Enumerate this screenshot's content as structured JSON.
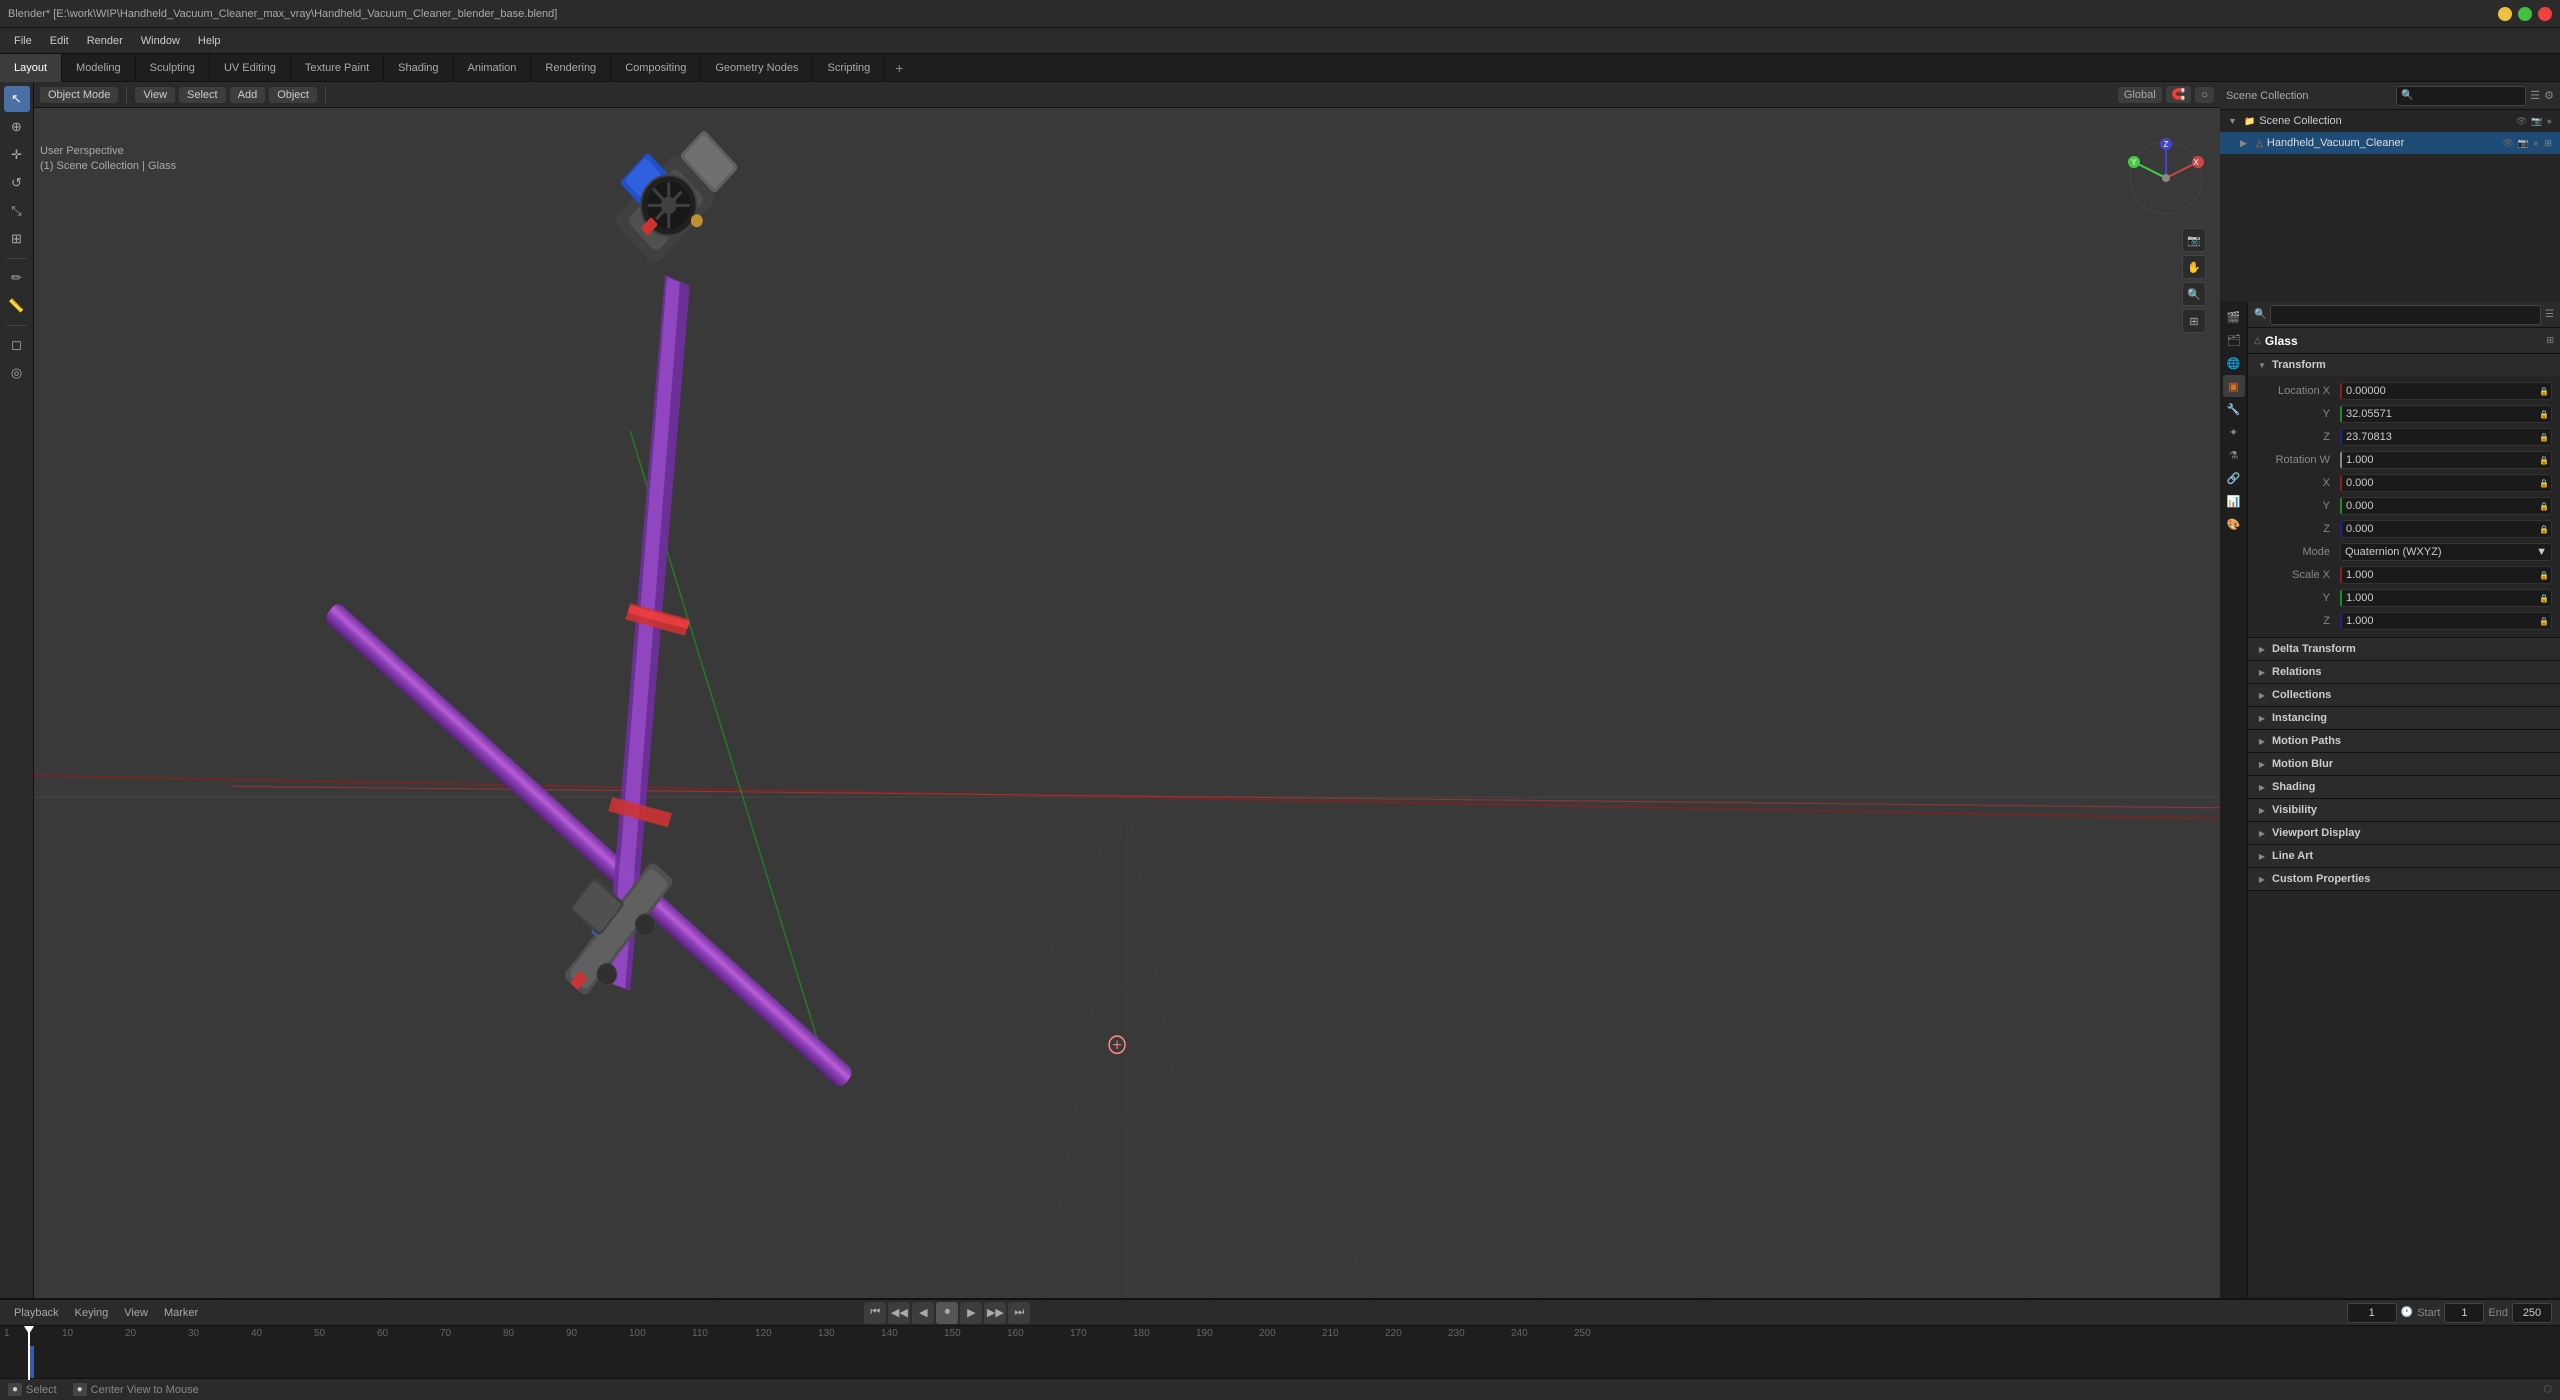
{
  "titlebar": {
    "title": "Blender* [E:\\work\\WIP\\Handheld_Vacuum_Cleaner_max_vray\\Handheld_Vacuum_Cleaner_blender_base.blend]"
  },
  "menus": {
    "items": [
      "File",
      "Edit",
      "Render",
      "Window",
      "Help"
    ]
  },
  "workspace_tabs": {
    "tabs": [
      "Layout",
      "Modeling",
      "Sculpting",
      "UV Editing",
      "Texture Paint",
      "Shading",
      "Animation",
      "Rendering",
      "Compositing",
      "Geometry Nodes",
      "Scripting"
    ],
    "active": "Layout",
    "plus": "+"
  },
  "viewport": {
    "mode": "Object Mode",
    "view_label": "View",
    "select_label": "Select",
    "add_label": "Add",
    "object_label": "Object",
    "transform_global": "Global",
    "overlay_info": {
      "line1": "User Perspective",
      "line2": "(1) Scene Collection | Glass"
    }
  },
  "left_toolbar": {
    "tools": [
      {
        "name": "select-tool",
        "icon": "↖",
        "active": true
      },
      {
        "name": "cursor-tool",
        "icon": "⊕",
        "active": false
      },
      {
        "name": "move-tool",
        "icon": "✛",
        "active": false
      },
      {
        "name": "rotate-tool",
        "icon": "↺",
        "active": false
      },
      {
        "name": "scale-tool",
        "icon": "⤡",
        "active": false
      },
      {
        "name": "transform-tool",
        "icon": "⊞",
        "active": false
      },
      {
        "name": "separator1",
        "separator": true
      },
      {
        "name": "annotate-tool",
        "icon": "✏",
        "active": false
      },
      {
        "name": "measure-tool",
        "icon": "📏",
        "active": false
      },
      {
        "name": "separator2",
        "separator": true
      },
      {
        "name": "object-tool",
        "icon": "◻",
        "active": false
      },
      {
        "name": "origin-tool",
        "icon": "◎",
        "active": false
      }
    ]
  },
  "outliner": {
    "title": "Scene Collection",
    "items": [
      {
        "name": "Scene Collection",
        "level": 0,
        "icon": "▼",
        "type": "collection"
      },
      {
        "name": "Handheld_Vacuum_Cleaner",
        "level": 1,
        "icon": "▶",
        "type": "object",
        "selected": true
      }
    ]
  },
  "properties": {
    "object_name": "Glass",
    "active_tab": "object",
    "tabs_icons": [
      "📷",
      "🔴",
      "🌐",
      "⬛",
      "👁",
      "✦",
      "🔗",
      "🧲",
      "🔧"
    ],
    "transform": {
      "title": "Transform",
      "location": {
        "label": "Location",
        "x": {
          "label": "X",
          "value": "0.00000"
        },
        "y": {
          "label": "Y",
          "value": "32.05571"
        },
        "z": {
          "label": "Z",
          "value": "23.70813"
        }
      },
      "rotation": {
        "label": "Rotation",
        "w": {
          "label": "W",
          "value": "1.000"
        },
        "x": {
          "label": "X",
          "value": "0.000"
        },
        "y": {
          "label": "Y",
          "value": "0.000"
        },
        "z": {
          "label": "Z",
          "value": "0.000"
        }
      },
      "mode": {
        "label": "Mode",
        "value": "Quaternion (WXYZ)"
      },
      "scale": {
        "label": "Scale",
        "x": {
          "label": "X",
          "value": "1.000"
        },
        "y": {
          "label": "Y",
          "value": "1.000"
        },
        "z": {
          "label": "Z",
          "value": "1.000"
        }
      }
    },
    "sections": [
      {
        "title": "Delta Transform",
        "collapsed": true
      },
      {
        "title": "Relations",
        "collapsed": true
      },
      {
        "title": "Collections",
        "collapsed": true
      },
      {
        "title": "Instancing",
        "collapsed": true
      },
      {
        "title": "Motion Paths",
        "collapsed": true
      },
      {
        "title": "Motion Blur",
        "collapsed": true
      },
      {
        "title": "Shading",
        "collapsed": true
      },
      {
        "title": "Visibility",
        "collapsed": true
      },
      {
        "title": "Viewport Display",
        "collapsed": true
      },
      {
        "title": "Line Art",
        "collapsed": true
      },
      {
        "title": "Custom Properties",
        "collapsed": true
      }
    ]
  },
  "timeline": {
    "menus": [
      "Playback",
      "Keying",
      "View",
      "Marker"
    ],
    "controls": {
      "jump_start": "⏮",
      "prev_frame": "⏪",
      "prev_keyframe": "⏮",
      "play": "▶",
      "next_keyframe": "⏭",
      "next_frame": "⏩",
      "jump_end": "⏭"
    },
    "frame_current": "1",
    "start_label": "Start",
    "start_value": "1",
    "end_label": "End",
    "end_value": "250",
    "ticks": [
      "1",
      "10",
      "20",
      "30",
      "40",
      "50",
      "60",
      "70",
      "80",
      "90",
      "100",
      "110",
      "120",
      "130",
      "140",
      "150",
      "160",
      "170",
      "180",
      "190",
      "200",
      "210",
      "220",
      "230",
      "240",
      "250"
    ],
    "playhead_frame": 1
  },
  "status_bar": {
    "select_hint": "Select",
    "view_hint": "Center View to Mouse"
  },
  "colors": {
    "accent_orange": "#e07020",
    "accent_blue": "#4a6fa5",
    "x_axis": "#8b2020",
    "y_axis": "#208b20",
    "z_axis": "#20208b",
    "selection": "#1f4b77"
  }
}
